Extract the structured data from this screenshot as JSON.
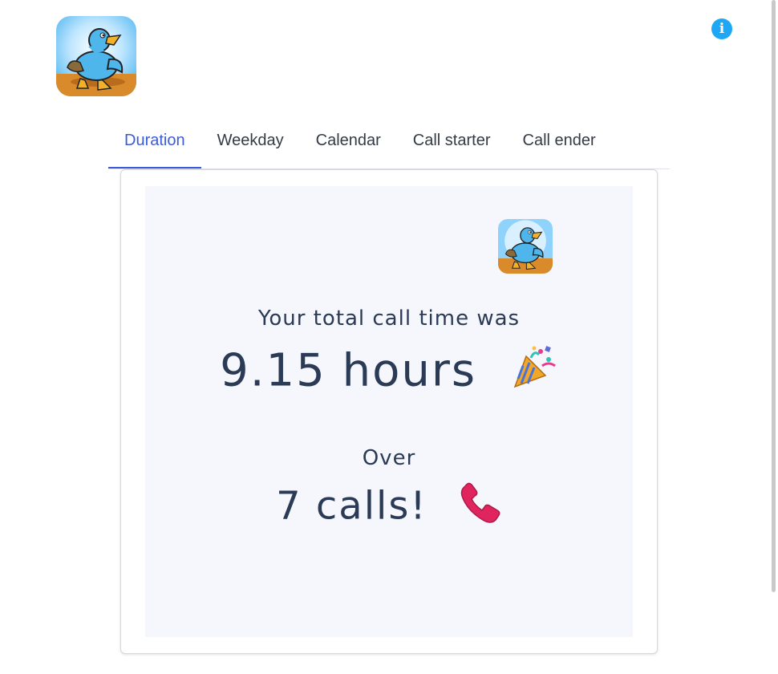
{
  "header": {
    "logo_icon": "duck-logo-icon",
    "info_icon": "info-icon",
    "info_symbol": "i",
    "info_color": "#1ea7f5"
  },
  "tabs": [
    {
      "label": "Duration",
      "active": true
    },
    {
      "label": "Weekday",
      "active": false
    },
    {
      "label": "Calendar",
      "active": false
    },
    {
      "label": "Call starter",
      "active": false
    },
    {
      "label": "Call ender",
      "active": false
    }
  ],
  "accent_color": "#3b5bdb",
  "card": {
    "logo_icon": "duck-logo-icon",
    "total_label": "Your total call time was",
    "total_value": "9.15 hours",
    "total_emoji": "party-popper-icon",
    "over_label": "Over",
    "calls_value": "7 calls!",
    "calls_emoji": "telephone-receiver-icon"
  }
}
